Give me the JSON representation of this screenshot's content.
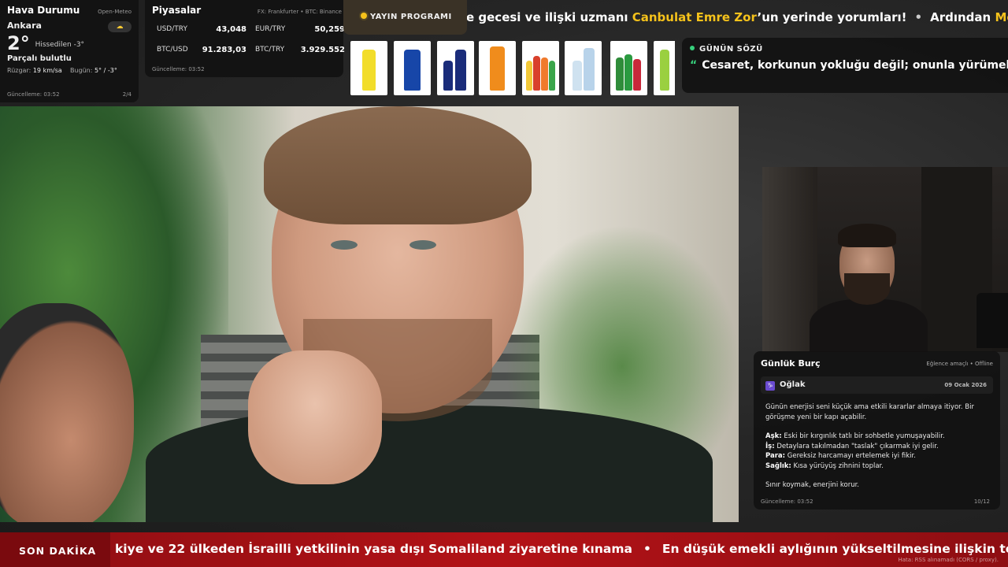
{
  "weather": {
    "title": "Hava Durumu",
    "source": "Open-Meteo",
    "city": "Ankara",
    "temp": "2°",
    "feels": "Hissedilen -3°",
    "condition": "Parçalı bulutlu",
    "wind_label": "Rüzgar:",
    "wind_value": "19 km/sa",
    "today_label": "Bugün:",
    "today_value": "5° / -3°",
    "updated": "Güncelleme: 03:52",
    "page": "2/4",
    "icon": "partly-cloudy-icon"
  },
  "markets": {
    "title": "Piyasalar",
    "source": "FX: Frankfurter • BTC: Binance",
    "items": [
      {
        "label": "USD/TRY",
        "value": "43,048"
      },
      {
        "label": "EUR/TRY",
        "value": "50,259"
      },
      {
        "label": "BTC/USD",
        "value": "91.283,03"
      },
      {
        "label": "BTC/TRY",
        "value": "3.929.552"
      }
    ],
    "updated": "Güncelleme: 03:52"
  },
  "schedule": {
    "label": "YAYIN PROGRAMI"
  },
  "top_ticker": {
    "part1": "e gecesi ve ilişki uzmanı ",
    "highlight1": "Canbulat Emre Zor",
    "part2": "’un yerinde yorumları!",
    "part3": "Ardından ",
    "highlight2": "Medce"
  },
  "quote": {
    "label": "GÜNÜN SÖZÜ",
    "mark": "“",
    "text": "Cesaret, korkunun yokluğu değil; onunla yürümektir. T"
  },
  "horoscope": {
    "title": "Günlük Burç",
    "source": "Eğlence amaçlı • Offline",
    "sign_icon": "♑",
    "sign": "Oğlak",
    "date": "09 Ocak 2026",
    "intro": "Günün enerjisi seni küçük ama etkili kararlar almaya itiyor. Bir görüşme yeni bir kapı açabilir.",
    "lines": [
      {
        "key": "Aşk:",
        "text": " Eski bir kırgınlık tatlı bir sohbetle yumuşayabilir."
      },
      {
        "key": "İş:",
        "text": " Detaylara takılmadan \"taslak\" çıkarmak iyi gelir."
      },
      {
        "key": "Para:",
        "text": " Gereksiz harcamayı ertelemek iyi fikir."
      },
      {
        "key": "Sağlık:",
        "text": " Kısa yürüyüş zihnini toplar."
      }
    ],
    "outro": "Sınır koymak, enerjini korur.",
    "updated": "Güncelleme: 03:52",
    "page": "10/12"
  },
  "breaking": {
    "label": "SON DAKİKA",
    "item1": "kiye ve 22 ülkeden İsrailli yetkilinin yasa dışı Somaliland ziyaretine kınama",
    "item2": "En düşük emekli aylığının yükseltilmesine ilişkin tek",
    "error": "Hata: RSS alınamadı (CORS / proxy)."
  },
  "colors": {
    "accent_yellow": "#f5c21b",
    "accent_green": "#37d17c",
    "breaking_red": "#b31217"
  }
}
